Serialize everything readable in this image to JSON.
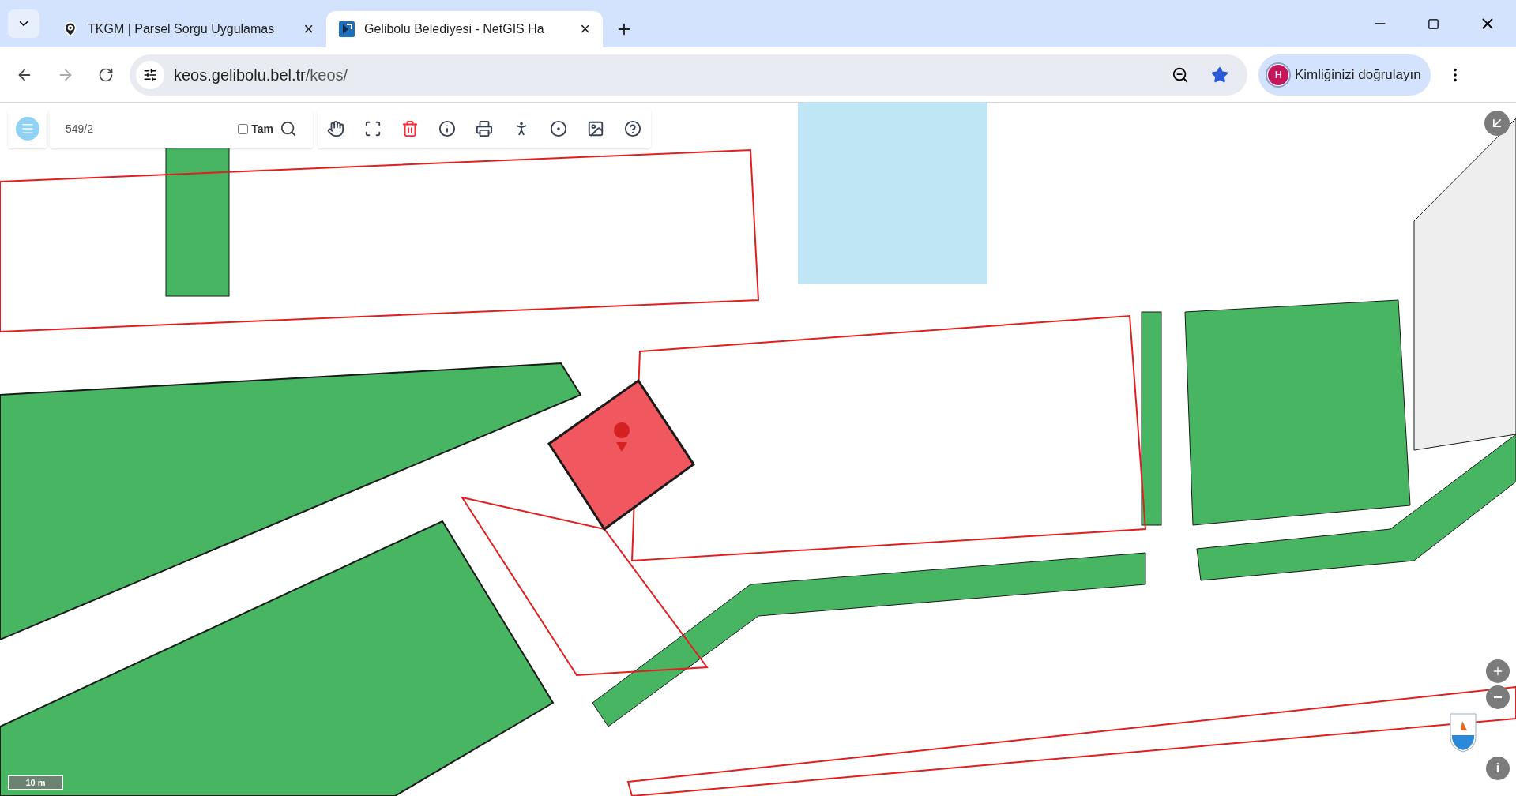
{
  "tabs": [
    {
      "title": "TKGM | Parsel Sorgu Uygulamas",
      "selected": false,
      "close": "×"
    },
    {
      "title": "Gelibolu Belediyesi - NetGIS Ha",
      "selected": true,
      "close": "×"
    }
  ],
  "address_bar": {
    "host": "keos.gelibolu.bel.tr",
    "path": "/keos/",
    "bookmarked": true
  },
  "profile": {
    "initial": "H",
    "label": "Kimliğinizi doğrulayın"
  },
  "map_toolbar": {
    "search_value": "549/2",
    "full_match": {
      "label": "Tam",
      "checked": false
    },
    "tools": [
      {
        "kind": "pan"
      },
      {
        "kind": "select"
      },
      {
        "kind": "delete"
      },
      {
        "kind": "info"
      },
      {
        "kind": "print"
      },
      {
        "kind": "street"
      },
      {
        "kind": "plan"
      },
      {
        "kind": "gallery"
      },
      {
        "kind": "help"
      }
    ]
  },
  "map": {
    "kind": "picture",
    "scale": "10 m",
    "info_button": "i"
  }
}
